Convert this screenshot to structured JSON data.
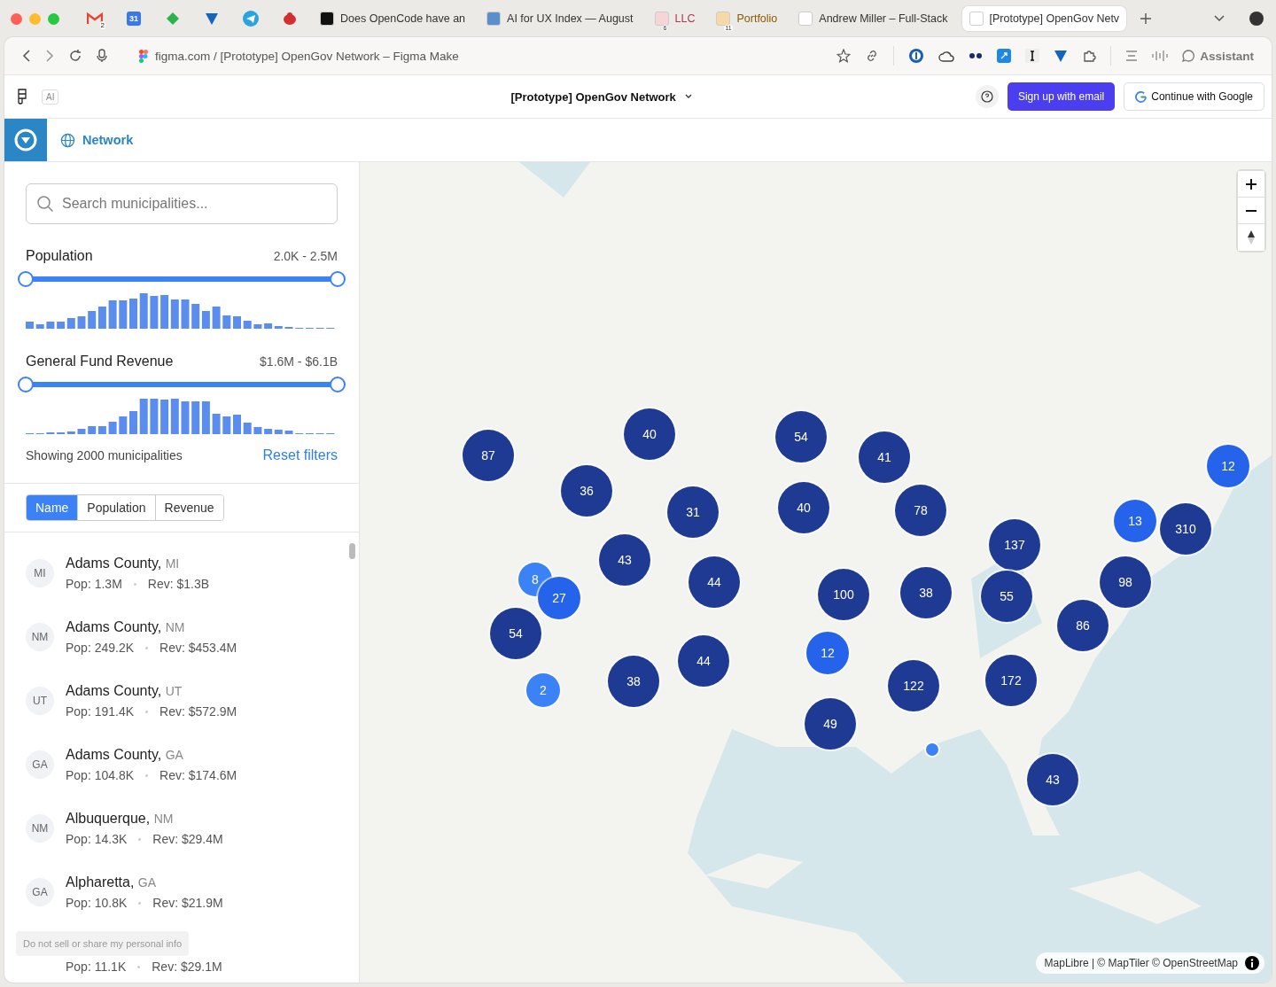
{
  "browser": {
    "pinned_tabs": [
      {
        "kind": "mail",
        "badge": "2"
      },
      {
        "kind": "calendar",
        "label": "31"
      },
      {
        "kind": "feed"
      },
      {
        "kind": "v"
      },
      {
        "kind": "telegram"
      },
      {
        "kind": "bird"
      }
    ],
    "tabs": [
      {
        "title": "Does OpenCode have an",
        "selected": false
      },
      {
        "title": "AI for UX Index — August",
        "selected": false
      },
      {
        "title": "LLC",
        "selected": false,
        "badge": "6",
        "color": "#b03a4a"
      },
      {
        "title": "Portfolio",
        "selected": false,
        "badge": "11",
        "color": "#8a5a00"
      },
      {
        "title": "Andrew Miller – Full-Stack",
        "selected": false
      },
      {
        "title": "[Prototype] OpenGov Netv",
        "selected": true
      }
    ],
    "address": "figma.com / [Prototype] OpenGov Network – Figma Make",
    "assistant": "Assistant"
  },
  "figma_header": {
    "badge": "AI",
    "title": "[Prototype] OpenGov Network",
    "signup": "Sign up with email",
    "google": "Continue with Google"
  },
  "app": {
    "nav": "Network",
    "search": {
      "placeholder": "Search municipalities..."
    },
    "filters": [
      {
        "label": "Population",
        "range": "2.0K - 2.5M",
        "level": 1
      },
      {
        "label": "General Fund Revenue",
        "range": "$1.6M - $6.1B",
        "level": 1
      }
    ],
    "showing": "Showing 2000 municipalities",
    "reset": "Reset filters",
    "sort_tabs": [
      {
        "label": "Name",
        "selected": true
      },
      {
        "label": "Population",
        "selected": false
      },
      {
        "label": "Revenue",
        "selected": false
      }
    ],
    "rows": [
      {
        "abbr": "MI",
        "name": "Adams County,",
        "state": "MI",
        "pop": "Pop: 1.3M",
        "rev": "Rev: $1.3B"
      },
      {
        "abbr": "NM",
        "name": "Adams County,",
        "state": "NM",
        "pop": "Pop: 249.2K",
        "rev": "Rev: $453.4M"
      },
      {
        "abbr": "UT",
        "name": "Adams County,",
        "state": "UT",
        "pop": "Pop: 191.4K",
        "rev": "Rev: $572.9M"
      },
      {
        "abbr": "GA",
        "name": "Adams County,",
        "state": "GA",
        "pop": "Pop: 104.8K",
        "rev": "Rev: $174.6M"
      },
      {
        "abbr": "NM",
        "name": "Albuquerque,",
        "state": "NM",
        "pop": "Pop: 14.3K",
        "rev": "Rev: $29.4M"
      },
      {
        "abbr": "GA",
        "name": "Alpharetta,",
        "state": "GA",
        "pop": "Pop: 10.8K",
        "rev": "Rev: $21.9M"
      },
      {
        "pop": "Pop: 11.1K",
        "rev": "Rev: $29.1M"
      }
    ],
    "privacy": "Do not sell or share my personal info"
  },
  "map": {
    "clusters": [
      {
        "count": "87",
        "color": "#1f3a93"
      },
      {
        "count": "40",
        "color": "#1f3a93"
      },
      {
        "count": "54",
        "color": "#1f3a93"
      },
      {
        "count": "41",
        "color": "#1f3a93"
      },
      {
        "count": "12",
        "color": "#2563eb"
      },
      {
        "count": "36",
        "color": "#1f3a93"
      },
      {
        "count": "31",
        "color": "#1f3a93"
      },
      {
        "count": "40",
        "color": "#1f3a93"
      },
      {
        "count": "78",
        "color": "#1f3a93"
      },
      {
        "count": "13",
        "color": "#2563eb"
      },
      {
        "count": "310",
        "color": "#1f3a93"
      },
      {
        "count": "137",
        "color": "#1f3a93"
      },
      {
        "count": "43",
        "color": "#1f3a93"
      },
      {
        "count": "8",
        "color": "#3b82f6"
      },
      {
        "count": "27",
        "color": "#2563eb"
      },
      {
        "count": "44",
        "color": "#1f3a93"
      },
      {
        "count": "100",
        "color": "#1f3a93"
      },
      {
        "count": "38",
        "color": "#1f3a93"
      },
      {
        "count": "55",
        "color": "#1f3a93"
      },
      {
        "count": "98",
        "color": "#1f3a93"
      },
      {
        "count": "54",
        "color": "#1f3a93"
      },
      {
        "count": "86",
        "color": "#1f3a93"
      },
      {
        "count": "12",
        "color": "#2563eb"
      },
      {
        "count": "2",
        "color": "#3b82f6"
      },
      {
        "count": "38",
        "color": "#1f3a93"
      },
      {
        "count": "44",
        "color": "#1f3a93"
      },
      {
        "count": "122",
        "color": "#1f3a93"
      },
      {
        "count": "172",
        "color": "#1f3a93"
      },
      {
        "count": "49",
        "color": "#1f3a93"
      },
      {
        "count": "43",
        "color": "#1f3a93"
      }
    ],
    "attribution": "MapLibre | © MapTiler © OpenStreetMap"
  }
}
